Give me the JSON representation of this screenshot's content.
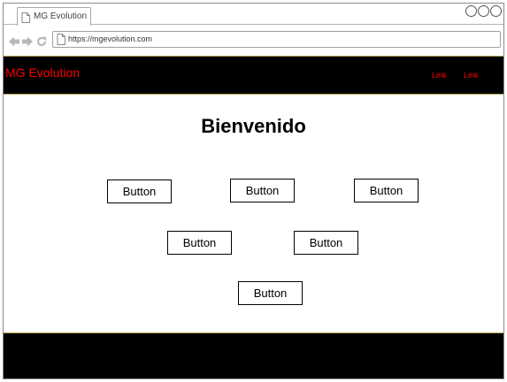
{
  "browser": {
    "tab_title": "MG Evolution",
    "url": "https://mgevolution.com"
  },
  "header": {
    "brand": "MG Evolution",
    "links": [
      "Link",
      "Link"
    ]
  },
  "main": {
    "title": "Bienvenido",
    "buttons": [
      "Button",
      "Button",
      "Button",
      "Button",
      "Button",
      "Button"
    ]
  },
  "colors": {
    "header_bg": "#000000",
    "brand_text": "#ff0000",
    "link_text": "#ff0000",
    "footer_bg": "#000000",
    "border_accent": "#b8a04a"
  }
}
